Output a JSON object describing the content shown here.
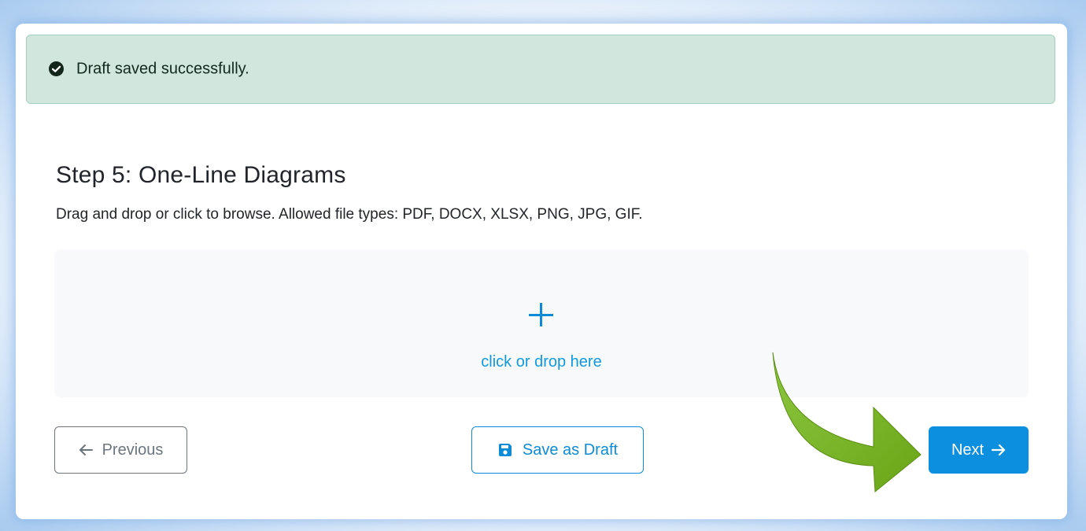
{
  "alert": {
    "icon": "check-circle-icon",
    "message": "Draft saved successfully.",
    "color": "#d1e7dd"
  },
  "step": {
    "title": "Step 5: One-Line Diagrams",
    "instructions": "Drag and drop or click to browse. Allowed file types: PDF, DOCX, XLSX, PNG, JPG, GIF."
  },
  "dropzone": {
    "icon": "plus-icon",
    "label": "click or drop here"
  },
  "buttons": {
    "previous": {
      "label": "Previous",
      "icon": "arrow-left-icon"
    },
    "save_draft": {
      "label": "Save as Draft",
      "icon": "floppy-disk-icon"
    },
    "next": {
      "label": "Next",
      "icon": "arrow-right-icon"
    }
  },
  "colors": {
    "primary": "#0d8fe0",
    "annotation_arrow": "#7ab51d"
  }
}
